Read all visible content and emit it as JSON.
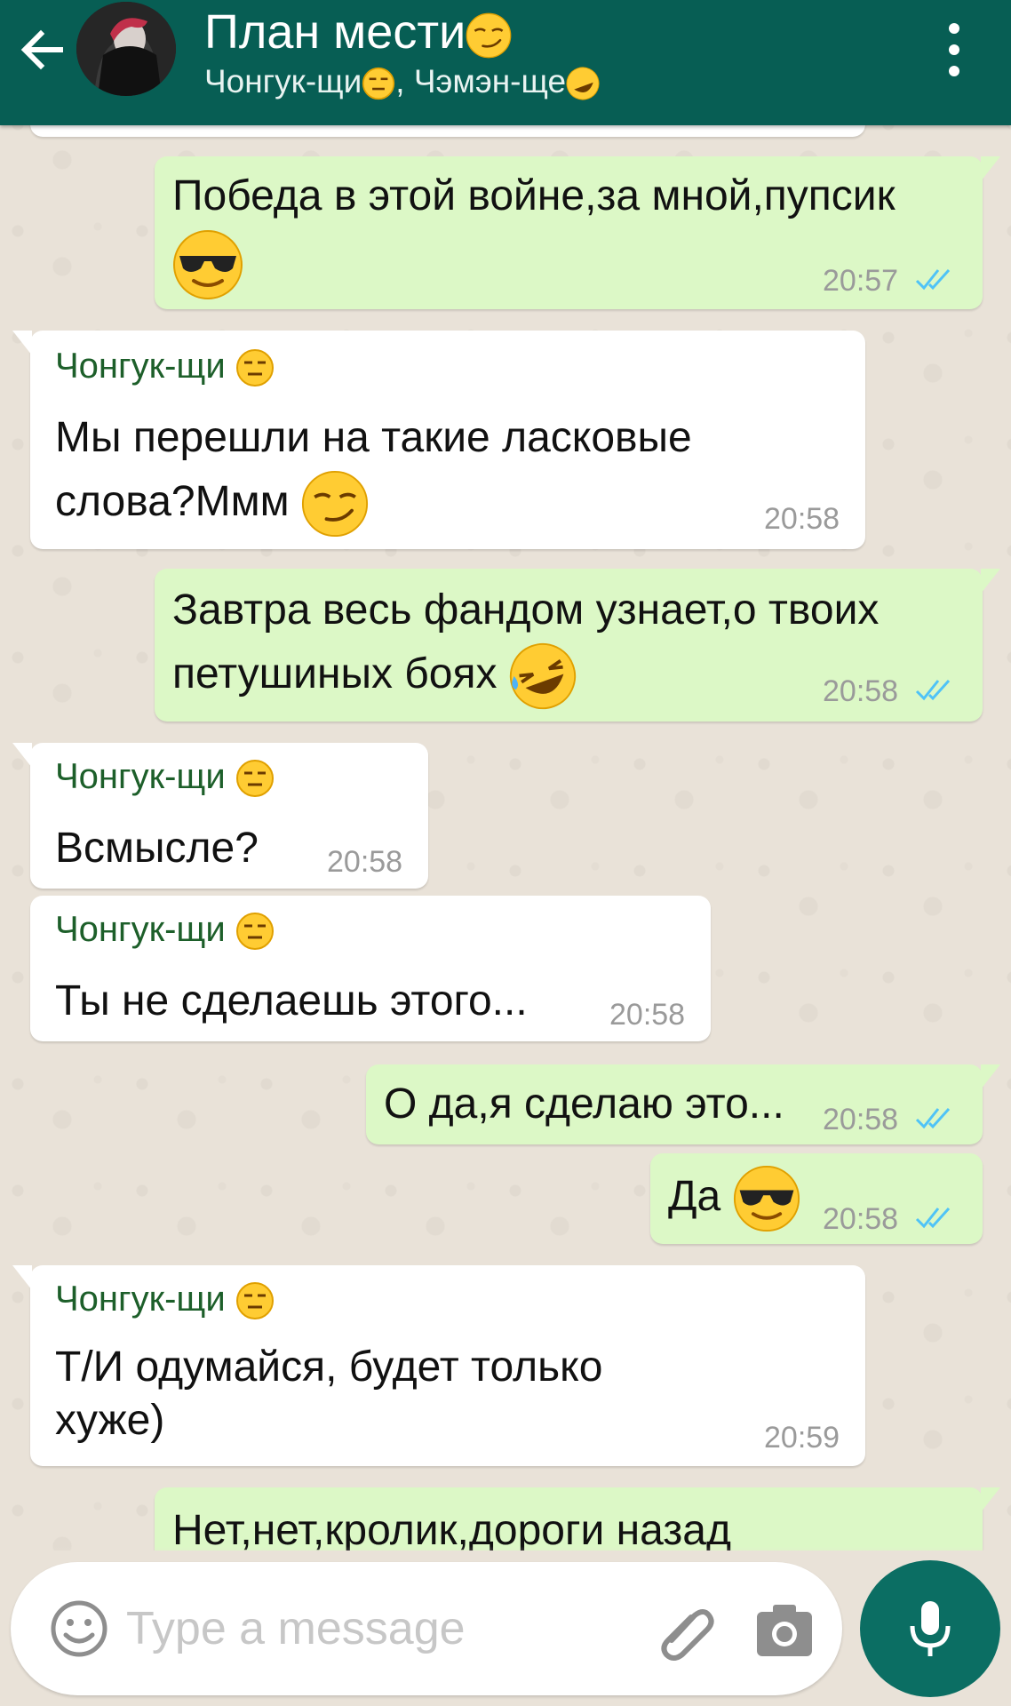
{
  "colors": {
    "header": "#075e54",
    "incoming": "#ffffff",
    "outgoing": "#dcf8c6",
    "sender": "#1d5f2a",
    "ticks": "#4fc3f7",
    "mic": "#0b6e63"
  },
  "header": {
    "title": "План мести",
    "title_emoji": "smirk-emoji",
    "subtitle_a": "Чонгук-щи",
    "subtitle_sep": ", ",
    "subtitle_b": "Чэмэн-ще",
    "back_icon": "back-arrow-icon",
    "menu_icon": "more-vert-icon"
  },
  "messages": [
    {
      "dir": "out",
      "lines": [
        "Победа в этой войне,за мной,пупсик"
      ],
      "emoji": "sunglasses-emoji",
      "time": "20:57",
      "read": true
    },
    {
      "dir": "in",
      "sender": "Чонгук-щи",
      "lines": [
        "Мы перешли на такие ласковые",
        "слова?Ммм"
      ],
      "emoji": "smirk-emoji",
      "time": "20:58"
    },
    {
      "dir": "out",
      "lines": [
        "Завтра весь фандом узнает,о твоих",
        "петушиных боях"
      ],
      "emoji": "rofl-emoji",
      "time": "20:58",
      "read": true
    },
    {
      "dir": "in",
      "sender": "Чонгук-щи",
      "lines": [
        "Всмысле?"
      ],
      "time": "20:58"
    },
    {
      "dir": "in",
      "sender": "Чонгук-щи",
      "lines": [
        "Ты не сделаешь этого..."
      ],
      "time": "20:58"
    },
    {
      "dir": "out",
      "lines": [
        "О да,я сделаю это..."
      ],
      "time": "20:58",
      "read": true
    },
    {
      "dir": "out",
      "lines": [
        "Да"
      ],
      "emoji": "sunglasses-emoji",
      "time": "20:58",
      "read": true
    },
    {
      "dir": "in",
      "sender": "Чонгук-щи",
      "lines": [
        "Т/И одумайся, будет только",
        "хуже)"
      ],
      "time": "20:59"
    },
    {
      "dir": "out",
      "lines": [
        "Нет,нет,кролик,дороги назад"
      ]
    }
  ],
  "input": {
    "placeholder": "Type a message",
    "emoji_icon": "emoji-smiley-icon",
    "attach_icon": "paperclip-icon",
    "camera_icon": "camera-icon",
    "mic_icon": "microphone-icon"
  }
}
